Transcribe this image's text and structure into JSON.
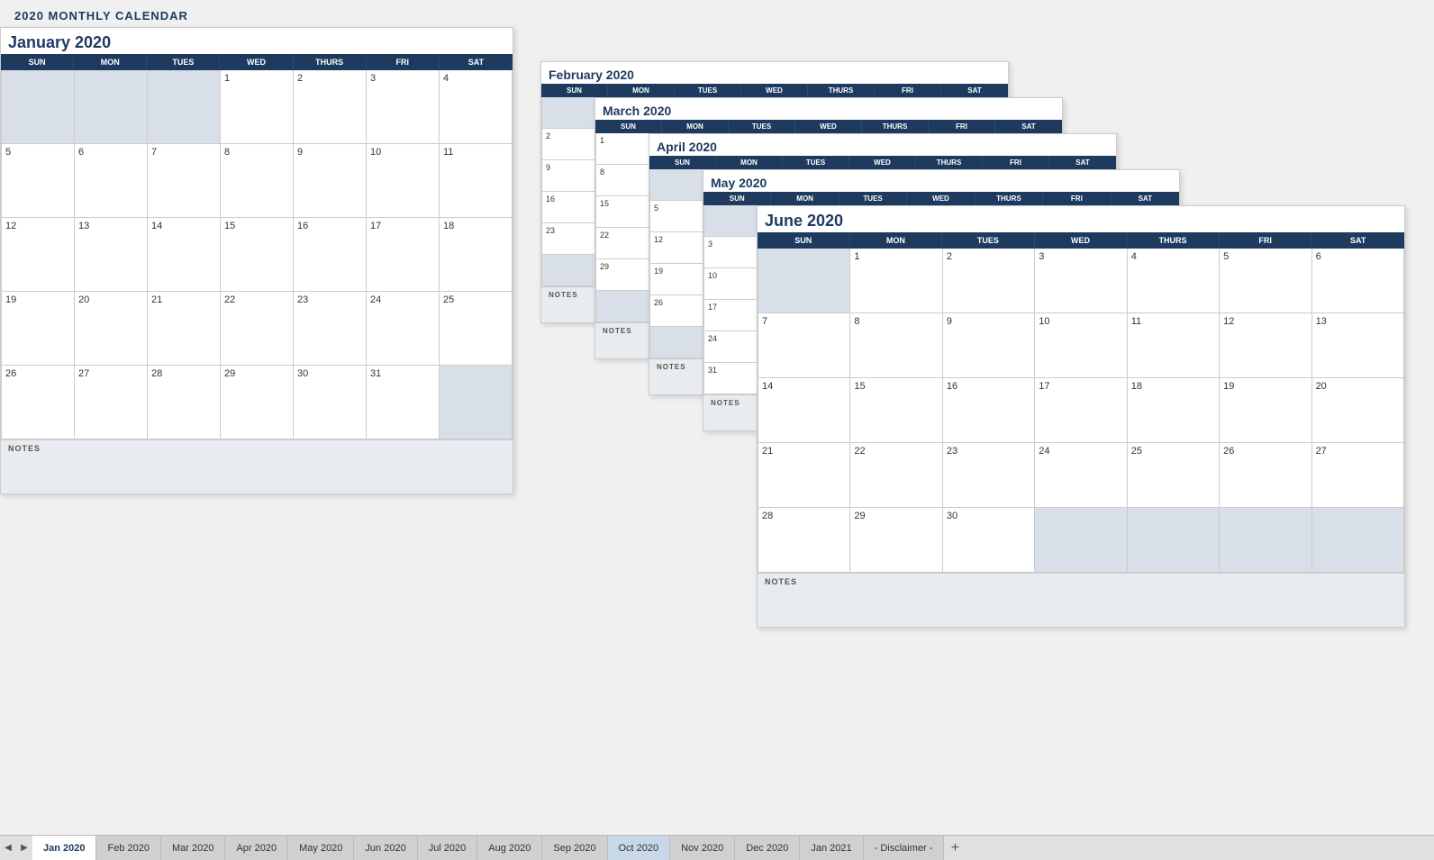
{
  "page": {
    "title": "2020  MONTHLY CALENDAR"
  },
  "january": {
    "title": "January 2020",
    "days": [
      "SUN",
      "MON",
      "TUES",
      "WED",
      "THURS",
      "FRI",
      "SAT"
    ],
    "weeks": [
      [
        "",
        "",
        "",
        "1",
        "2",
        "3",
        "4"
      ],
      [
        "5",
        "6",
        "7",
        "8",
        "9",
        "10",
        "11"
      ],
      [
        "12",
        "13",
        "14",
        "15",
        "16",
        "17",
        "18"
      ],
      [
        "19",
        "20",
        "21",
        "22",
        "23",
        "24",
        "25"
      ],
      [
        "26",
        "27",
        "28",
        "29",
        "30",
        "31",
        ""
      ]
    ],
    "notes_label": "NOTES"
  },
  "february": {
    "title": "February 2020",
    "days": [
      "SUN",
      "MON",
      "TUES",
      "WED",
      "THURS",
      "FRI",
      "SAT"
    ],
    "notes_label": "NOTES"
  },
  "march": {
    "title": "March 2020",
    "days": [
      "SUN",
      "MON",
      "TUES",
      "WED",
      "THURS",
      "FRI",
      "SAT"
    ],
    "notes_label": "NOTES"
  },
  "april": {
    "title": "April 2020",
    "days": [
      "SUN",
      "MON",
      "TUES",
      "WED",
      "THURS",
      "FRI",
      "SAT"
    ],
    "notes_label": "NOTES"
  },
  "may": {
    "title": "May 2020",
    "days": [
      "SUN",
      "MON",
      "TUES",
      "WED",
      "THURS",
      "FRI",
      "SAT"
    ],
    "notes_label": "NOTES"
  },
  "june": {
    "title": "June 2020",
    "days": [
      "SUN",
      "MON",
      "TUES",
      "WED",
      "THURS",
      "FRI",
      "SAT"
    ],
    "weeks": [
      [
        "",
        "1",
        "2",
        "3",
        "4",
        "5",
        "6"
      ],
      [
        "7",
        "8",
        "9",
        "10",
        "11",
        "12",
        "13"
      ],
      [
        "14",
        "15",
        "16",
        "17",
        "18",
        "19",
        "20"
      ],
      [
        "21",
        "22",
        "23",
        "24",
        "25",
        "26",
        "27"
      ],
      [
        "28",
        "29",
        "30",
        "",
        "",
        "",
        ""
      ]
    ],
    "notes_label": "NOTES"
  },
  "tabs": [
    {
      "label": "Jan 2020",
      "active": true
    },
    {
      "label": "Feb 2020",
      "active": false
    },
    {
      "label": "Mar 2020",
      "active": false
    },
    {
      "label": "Apr 2020",
      "active": false
    },
    {
      "label": "May 2020",
      "active": false
    },
    {
      "label": "Jun 2020",
      "active": false
    },
    {
      "label": "Jul 2020",
      "active": false
    },
    {
      "label": "Aug 2020",
      "active": false
    },
    {
      "label": "Sep 2020",
      "active": false
    },
    {
      "label": "Oct 2020",
      "active": false
    },
    {
      "label": "Nov 2020",
      "active": false
    },
    {
      "label": "Dec 2020",
      "active": false
    },
    {
      "label": "Jan 2021",
      "active": false
    },
    {
      "label": "- Disclaimer -",
      "active": false
    }
  ]
}
